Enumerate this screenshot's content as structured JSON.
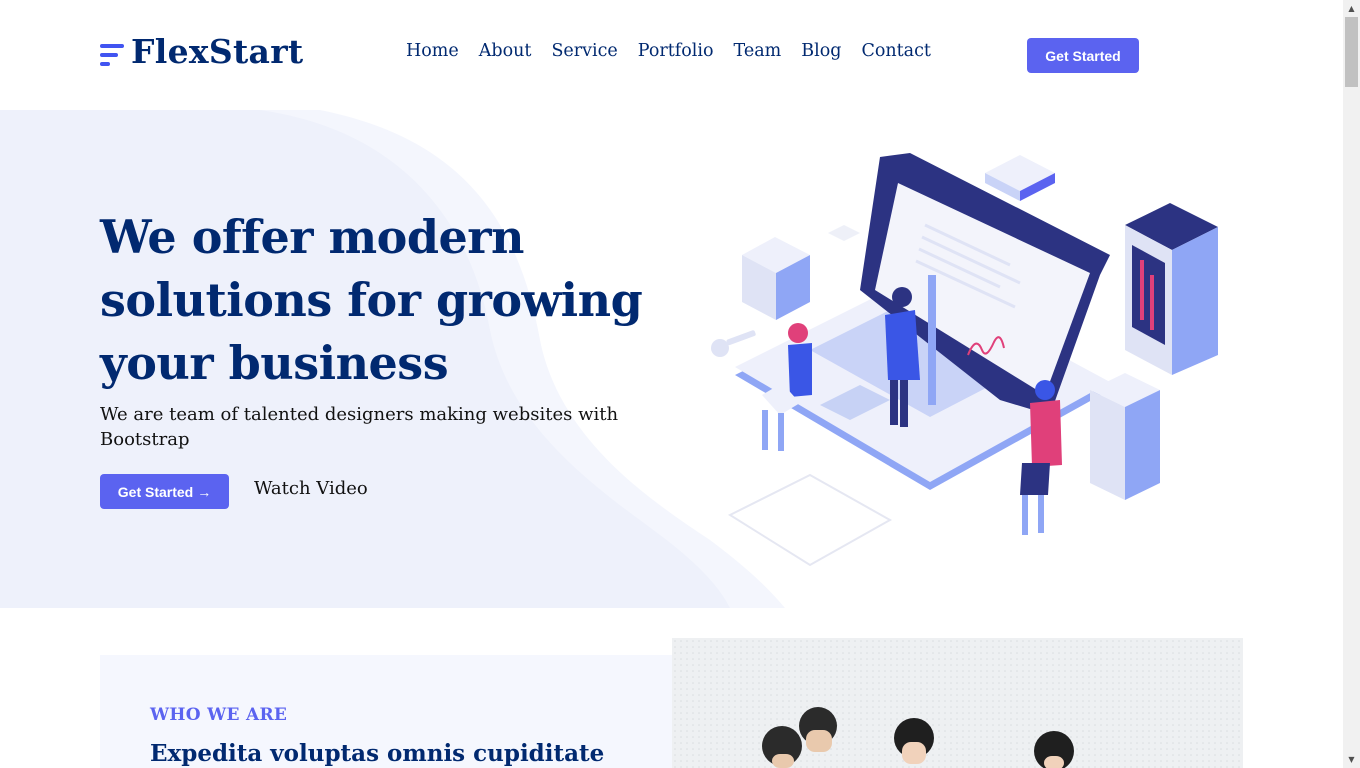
{
  "header": {
    "logo": "FlexStart",
    "nav": [
      {
        "label": "Home"
      },
      {
        "label": "About"
      },
      {
        "label": "Service"
      },
      {
        "label": "Portfolio"
      },
      {
        "label": "Team"
      },
      {
        "label": "Blog"
      },
      {
        "label": "Contact"
      }
    ],
    "cta": "Get Started"
  },
  "hero": {
    "title": "We offer modern solutions for growing your business",
    "subtitle": "We are team of talented designers making websites with Bootstrap",
    "cta": "Get Started",
    "cta_icon": "arrow-right-icon",
    "watch": "Watch Video",
    "illustration": "isometric-laptop-team-illustration"
  },
  "about": {
    "eyebrow": "WHO WE ARE",
    "title": "Expedita voluptas omnis cupiditate"
  },
  "colors": {
    "primary": "#4154f1",
    "navy": "#012970",
    "hero_bg": "#f0f2fc"
  }
}
